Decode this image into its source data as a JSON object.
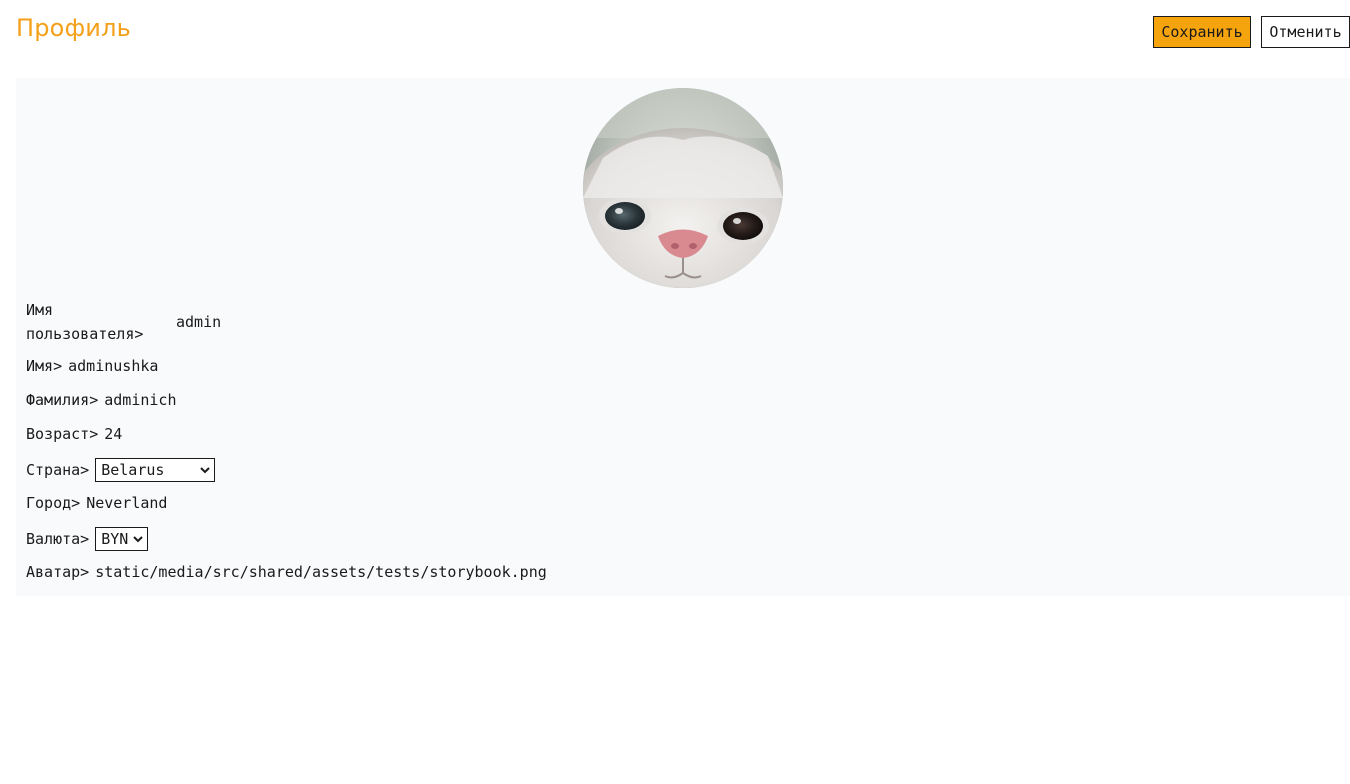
{
  "header": {
    "title": "Профиль",
    "save_label": "Сохранить",
    "cancel_label": "Отменить"
  },
  "profile": {
    "avatar_alt": "avatar",
    "fields": {
      "username": {
        "label": "Имя пользователя>",
        "value": "admin"
      },
      "first_name": {
        "label": "Имя>",
        "value": "adminushka"
      },
      "last_name": {
        "label": "Фамилия>",
        "value": "adminich"
      },
      "age": {
        "label": "Возраст>",
        "value": "24"
      },
      "country": {
        "label": "Страна>",
        "value": "Belarus"
      },
      "city": {
        "label": "Город>",
        "value": "Neverland"
      },
      "currency": {
        "label": "Валюта>",
        "value": "BYN"
      },
      "avatar": {
        "label": "Аватар>",
        "value": "static/media/src/shared/assets/tests/storybook.png"
      }
    }
  },
  "colors": {
    "accent": "#f5a01a",
    "save_button": "#f5a40e",
    "card_background": "#f9fafc"
  },
  "icons": {
    "country_select": "chevron-down-icon",
    "currency_select": "chevron-down-icon"
  }
}
